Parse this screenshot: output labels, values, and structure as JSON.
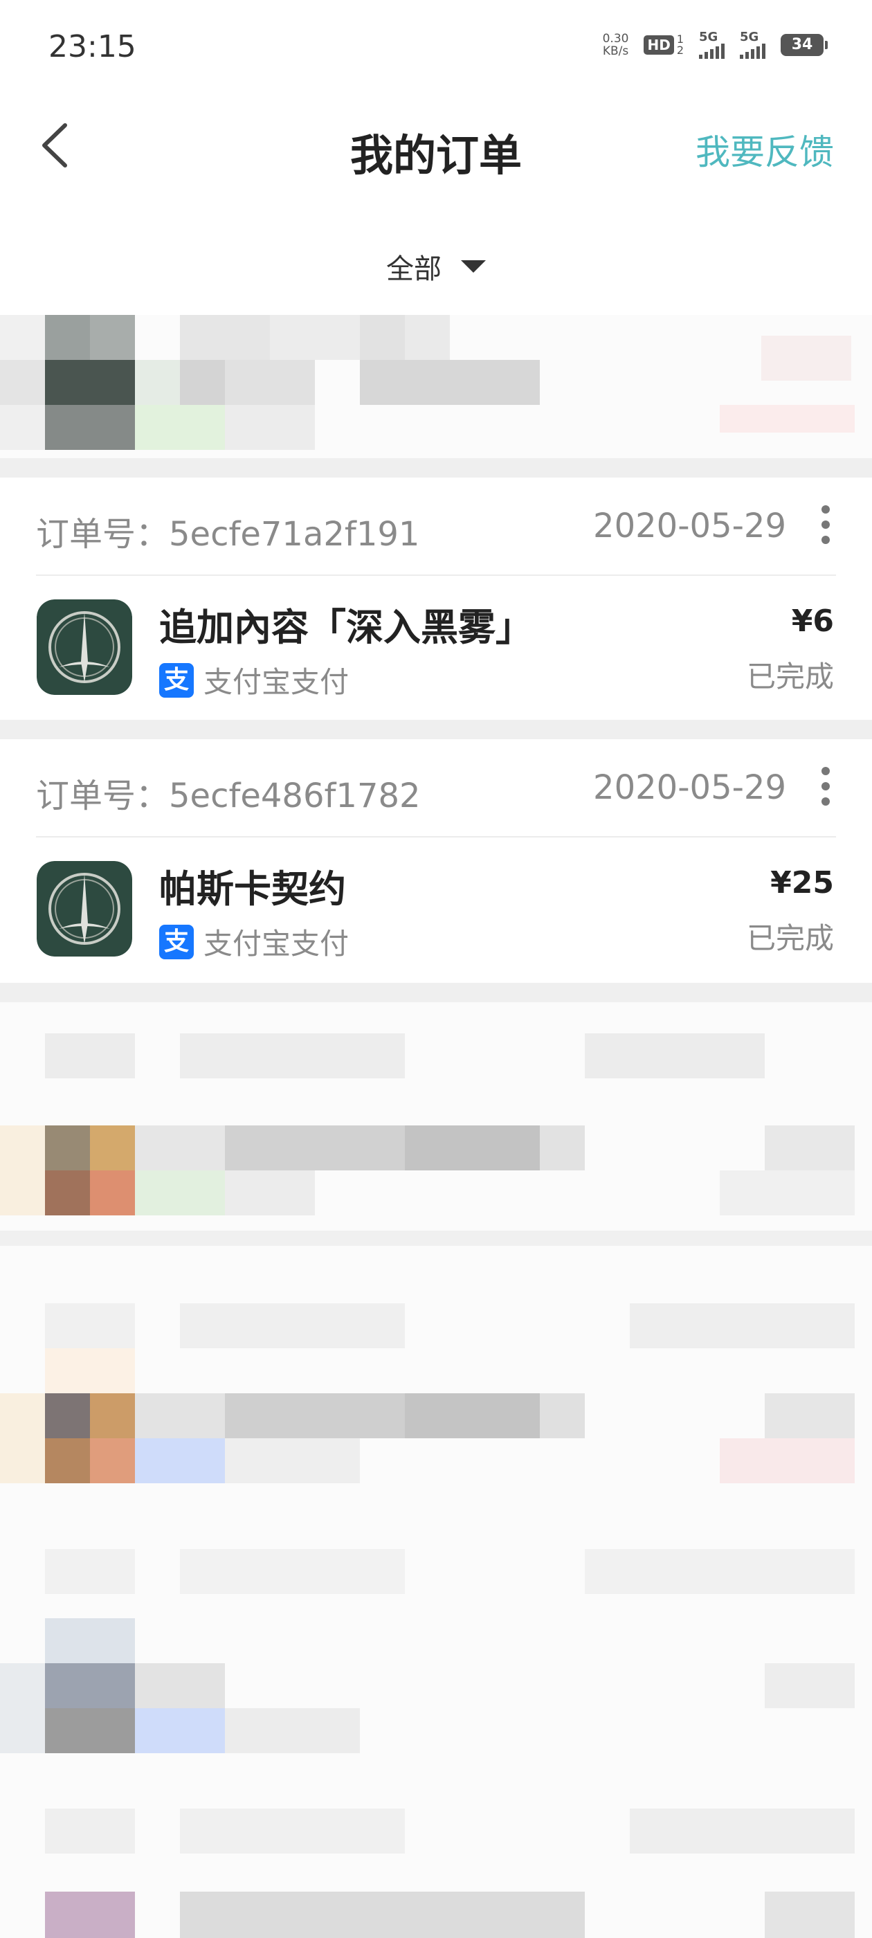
{
  "status_bar": {
    "time": "23:15",
    "net_speed_value": "0.30",
    "net_speed_unit": "KB/s",
    "hd_label": "HD",
    "hd_sim_top": "1",
    "hd_sim_bottom": "2",
    "signal1_label": "5G",
    "signal2_label": "5G",
    "battery": "34"
  },
  "header": {
    "title": "我的订单",
    "feedback": "我要反馈"
  },
  "filter": {
    "selected": "全部"
  },
  "orders": [
    {
      "order_no": "订单号：5ecfe71a2f191",
      "date": "2020-05-29",
      "product": "追加內容「深入黑雾」",
      "pay_method": "支付宝支付",
      "pay_icon_char": "支",
      "price": "¥6",
      "status": "已完成"
    },
    {
      "order_no": "订单号：5ecfe486f1782",
      "date": "2020-05-29",
      "product": "帕斯卡契约",
      "pay_method": "支付宝支付",
      "pay_icon_char": "支",
      "price": "¥25",
      "status": "已完成"
    }
  ],
  "colors": {
    "accent": "#4fb8bf",
    "alipay": "#1677ff",
    "separator": "#efefef",
    "app_icon_bg": "#2d4a40"
  }
}
